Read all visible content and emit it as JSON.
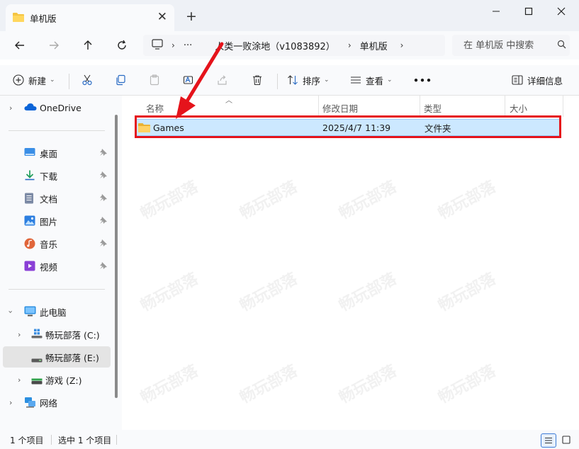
{
  "tab": {
    "title": "单机版",
    "close": "✕",
    "new_tab": "+"
  },
  "window_controls": {
    "minimize": "—",
    "maximize": "☐",
    "close": "✕"
  },
  "address": {
    "ellipsis": "···",
    "crumbs": [
      "人类一败涂地（v1083892）",
      "单机版"
    ],
    "separator": "›"
  },
  "search": {
    "placeholder": "在 单机版 中搜索"
  },
  "toolbar": {
    "new_label": "新建",
    "sort_label": "排序",
    "view_label": "查看",
    "more_label": "•••",
    "details_label": "详细信息"
  },
  "sidebar": {
    "onedrive": "OneDrive",
    "quick": [
      {
        "label": "桌面",
        "icon": "desktop-icon"
      },
      {
        "label": "下载",
        "icon": "download-icon"
      },
      {
        "label": "文档",
        "icon": "document-icon"
      },
      {
        "label": "图片",
        "icon": "picture-icon"
      },
      {
        "label": "音乐",
        "icon": "music-icon"
      },
      {
        "label": "视频",
        "icon": "video-icon"
      }
    ],
    "this_pc": "此电脑",
    "drives": [
      {
        "label": "畅玩部落 (C:)",
        "selected": false
      },
      {
        "label": "畅玩部落 (E:)",
        "selected": true
      },
      {
        "label": "游戏 (Z:)",
        "selected": false
      }
    ],
    "network": "网络"
  },
  "columns": {
    "name": "名称",
    "date": "修改日期",
    "type": "类型",
    "size": "大小"
  },
  "files": [
    {
      "name": "Games",
      "date": "2025/4/7 11:39",
      "type": "文件夹",
      "size": ""
    }
  ],
  "status": {
    "count": "1 个项目",
    "selected": "选中 1 个项目"
  },
  "colors": {
    "accent": "#0067c0",
    "selection": "#cce8ff",
    "highlight_border": "#e5131b",
    "folder": "#f5c542"
  }
}
